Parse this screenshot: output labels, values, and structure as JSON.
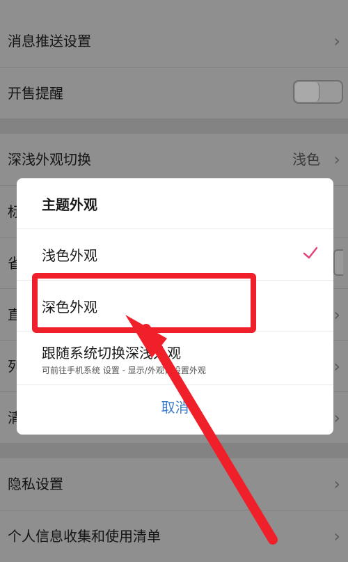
{
  "settings": {
    "push": "消息推送设置",
    "sale_reminder": "开售提醒",
    "theme_switch": "深浅外观切换",
    "theme_value": "浅色",
    "peek_1": "标",
    "peek_2": "省",
    "peek_3": "直",
    "peek_4": "列",
    "peek_5": "清",
    "privacy": "隐私设置",
    "personal_info": "个人信息收集和使用清单",
    "chevron": "›"
  },
  "dialog": {
    "title": "主题外观",
    "option_light": "浅色外观",
    "option_dark": "深色外观",
    "option_system": "跟随系统切换深浅外观",
    "option_system_hint": "可前往手机系统 设置 - 显示/外观，设置外观",
    "cancel": "取消",
    "check_color": "#e0457b"
  },
  "annotation": {
    "highlight_color": "#f0202a"
  }
}
